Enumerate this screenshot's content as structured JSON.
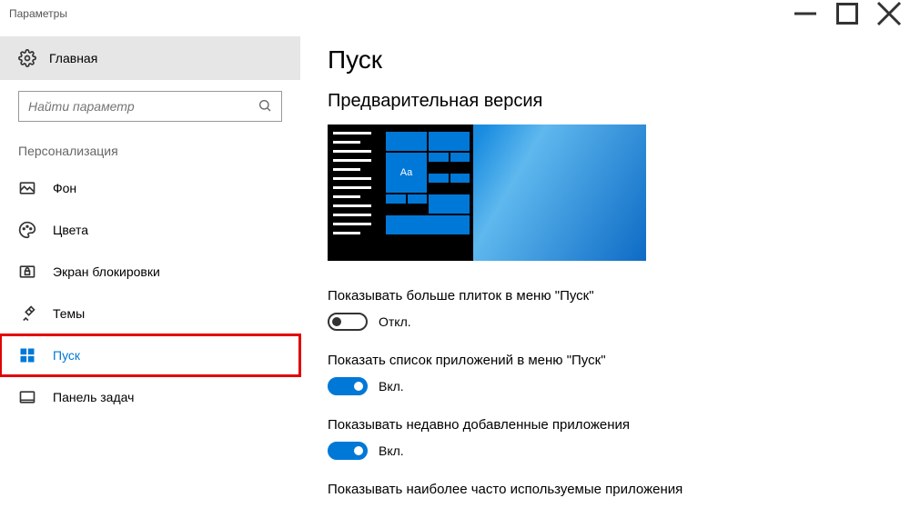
{
  "window": {
    "title": "Параметры"
  },
  "sidebar": {
    "home_label": "Главная",
    "search_placeholder": "Найти параметр",
    "category_label": "Персонализация",
    "items": [
      {
        "label": "Фон",
        "icon": "picture-icon"
      },
      {
        "label": "Цвета",
        "icon": "palette-icon"
      },
      {
        "label": "Экран блокировки",
        "icon": "lockscreen-icon"
      },
      {
        "label": "Темы",
        "icon": "themes-icon"
      },
      {
        "label": "Пуск",
        "icon": "start-icon",
        "active": true,
        "highlighted": true
      },
      {
        "label": "Панель задач",
        "icon": "taskbar-icon"
      }
    ]
  },
  "content": {
    "page_title": "Пуск",
    "section_title": "Предварительная версия",
    "preview_tile_text": "Aa",
    "settings": [
      {
        "label": "Показывать больше плиток в меню \"Пуск\"",
        "state": false,
        "state_label": "Откл."
      },
      {
        "label": "Показать список приложений в меню \"Пуск\"",
        "state": true,
        "state_label": "Вкл."
      },
      {
        "label": "Показывать недавно добавленные приложения",
        "state": true,
        "state_label": "Вкл."
      },
      {
        "label": "Показывать наиболее часто используемые приложения",
        "state": null,
        "state_label": ""
      }
    ]
  }
}
